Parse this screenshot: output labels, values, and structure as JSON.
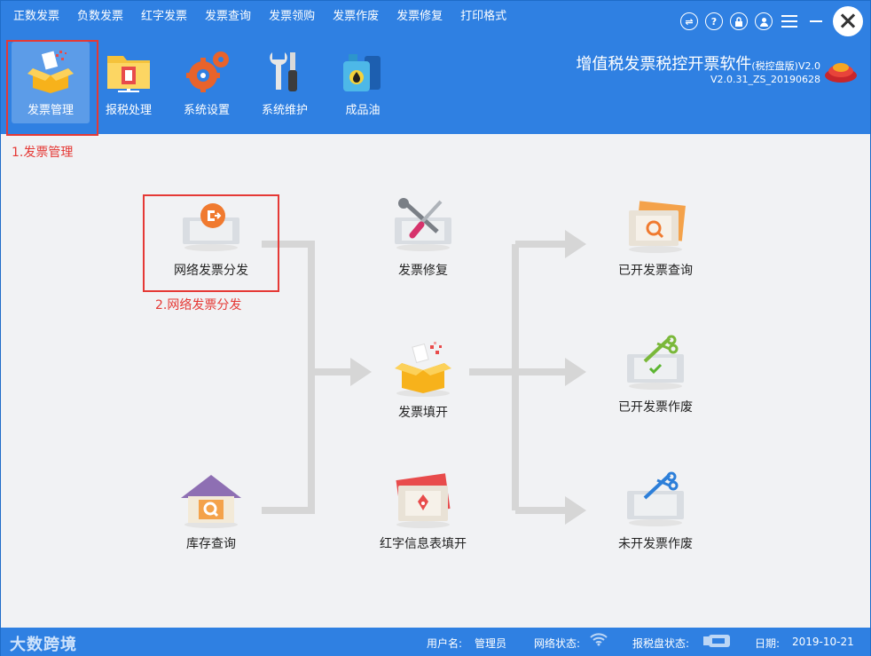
{
  "menu": [
    "正数发票",
    "负数发票",
    "红字发票",
    "发票查询",
    "发票领购",
    "发票作废",
    "发票修复",
    "打印格式"
  ],
  "window_controls": {
    "swap_icon": "⇌",
    "help_icon": "?",
    "lock_icon": "🔒",
    "user_icon": "👤"
  },
  "toolbar": [
    {
      "label": "发票管理",
      "icon": "invoice-box-icon"
    },
    {
      "label": "报税处理",
      "icon": "tax-folder-icon"
    },
    {
      "label": "系统设置",
      "icon": "gears-icon"
    },
    {
      "label": "系统维护",
      "icon": "tools-icon"
    },
    {
      "label": "成品油",
      "icon": "oil-can-icon"
    }
  ],
  "app": {
    "title": "增值税发票税控开票软件",
    "edition": "(税控盘版)",
    "title_ver": "V2.0",
    "version": "V2.0.31_ZS_20190628"
  },
  "annotations": {
    "step1": "1.发票管理",
    "step2": "2.网络发票分发"
  },
  "nodes": {
    "network_distribute": "网络发票分发",
    "invoice_repair": "发票修复",
    "issued_query": "已开发票查询",
    "invoice_fill": "发票填开",
    "issued_void": "已开发票作废",
    "stock_query": "库存查询",
    "red_info_fill": "红字信息表填开",
    "unissued_void": "未开发票作废"
  },
  "status": {
    "brand": "大数跨境",
    "user_label": "用户名:",
    "user_value": "管理员",
    "network_label": "网络状态:",
    "taxdisk_label": "报税盘状态:",
    "date_label": "日期:",
    "date_value": "2019-10-21"
  },
  "colors": {
    "header_blue": "#2f80e2",
    "highlight_red": "#e53935",
    "flow_gray": "#d6d6d6"
  }
}
